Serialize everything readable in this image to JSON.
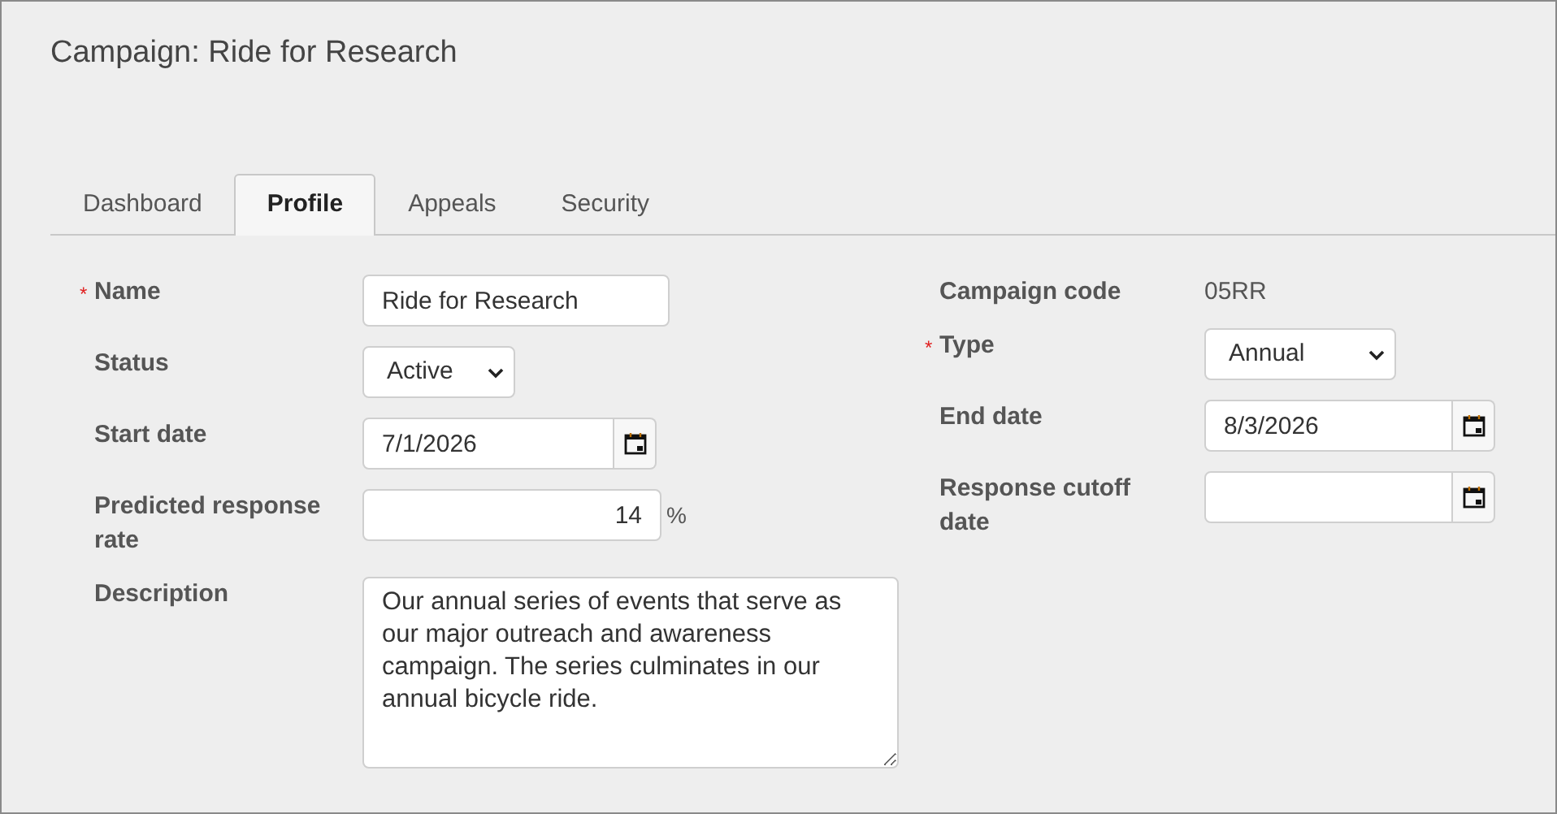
{
  "page_title": "Campaign: Ride for Research",
  "tabs": [
    {
      "label": "Dashboard",
      "selected": false
    },
    {
      "label": "Profile",
      "selected": true
    },
    {
      "label": "Appeals",
      "selected": false
    },
    {
      "label": "Security",
      "selected": false
    }
  ],
  "left_fields": [
    {
      "kind": "text",
      "label": "Name",
      "required_marker": "*",
      "value": "Ride for Research"
    },
    {
      "kind": "select",
      "label": "Status",
      "value": "Active"
    },
    {
      "kind": "date",
      "label": "Start date",
      "value": "7/1/2026"
    },
    {
      "kind": "number",
      "label": "Predicted response rate",
      "value": "14",
      "suffix": "%"
    },
    {
      "kind": "textarea",
      "label": "Description",
      "value": "Our annual series of events that serve as our major outreach and awareness campaign. The series culminates in our annual bicycle ride."
    }
  ],
  "right_fields": [
    {
      "kind": "static",
      "label": "Campaign code",
      "value": "05RR"
    },
    {
      "kind": "select",
      "label": "Type",
      "required_marker": "*",
      "value": "Annual"
    },
    {
      "kind": "date",
      "label": "End date",
      "value": "8/3/2026"
    },
    {
      "kind": "date",
      "label": "Response cutoff date"
    }
  ]
}
